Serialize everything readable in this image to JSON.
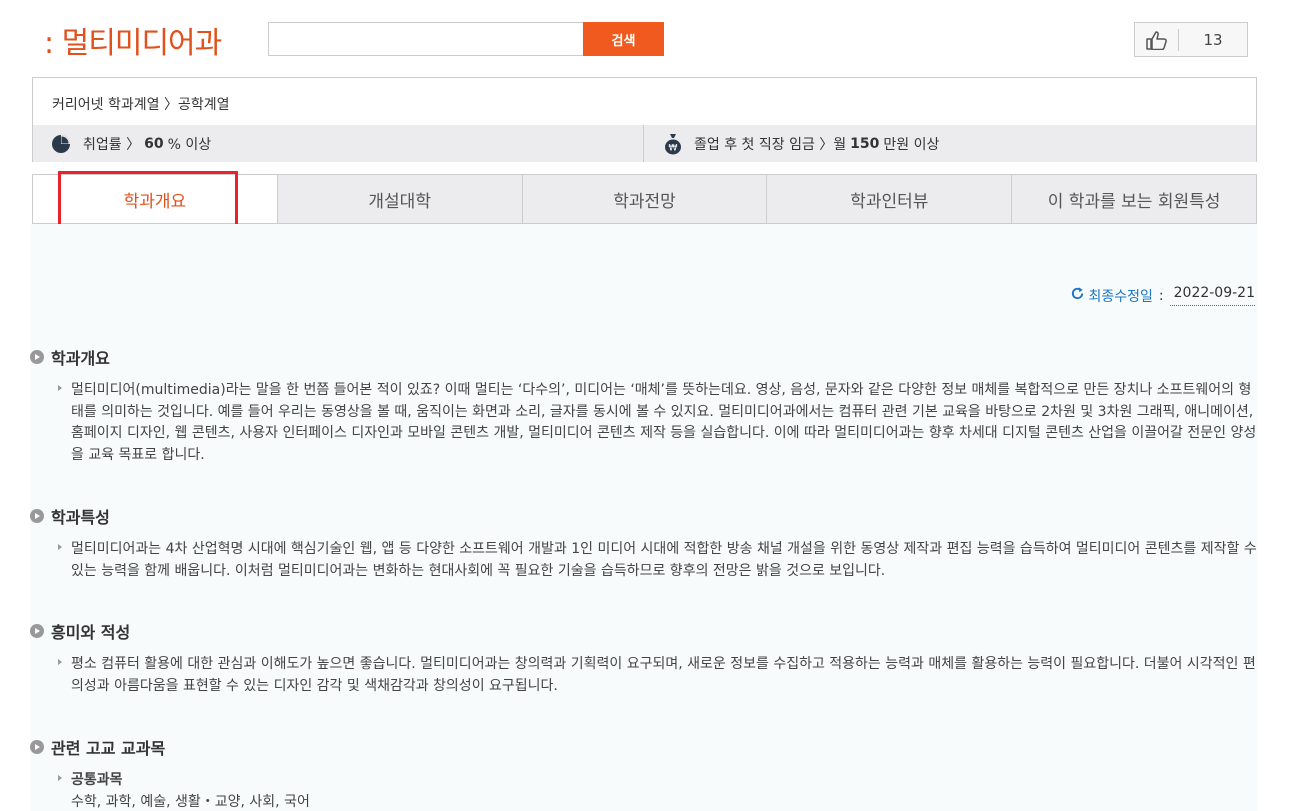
{
  "header": {
    "title": ": 멀티미디어과",
    "search_placeholder": "",
    "search_button": "검색",
    "like_count": "13"
  },
  "breadcrumb": {
    "text": "커리어넷 학과계열 〉공학계열"
  },
  "stats": {
    "employment_label": "취업률 〉",
    "employment_value": "60",
    "employment_unit": "% 이상",
    "salary_label": "졸업 후 첫 직장 임금 〉월",
    "salary_value": "150",
    "salary_unit": "만원 이상"
  },
  "tabs": [
    {
      "label": "학과개요"
    },
    {
      "label": "개설대학"
    },
    {
      "label": "학과전망"
    },
    {
      "label": "학과인터뷰"
    },
    {
      "label": "이 학과를 보는 회원특성"
    }
  ],
  "updated": {
    "label": "최종수정일",
    "separator": ":",
    "date": "2022-09-21"
  },
  "sections": [
    {
      "title": "학과개요",
      "body": "멀티미디어(multimedia)라는 말을 한 번쯤 들어본 적이 있죠? 이때 멀티는 ‘다수의’, 미디어는 ‘매체’를 뜻하는데요. 영상, 음성, 문자와 같은 다양한 정보 매체를 복합적으로 만든 장치나 소프트웨어의 형태를 의미하는 것입니다. 예를 들어 우리는 동영상을 볼 때, 움직이는 화면과 소리, 글자를 동시에 볼 수 있지요. 멀티미디어과에서는 컴퓨터 관련 기본 교육을 바탕으로 2차원 및 3차원 그래픽, 애니메이션, 홈페이지 디자인, 웹 콘텐츠, 사용자 인터페이스 디자인과 모바일 콘텐츠 개발, 멀티미디어 콘텐츠 제작 등을 실습합니다. 이에 따라 멀티미디어과는 향후 차세대 디지털 콘텐츠 산업을 이끌어갈 전문인 양성을 교육 목표로 합니다."
    },
    {
      "title": "학과특성",
      "body": "멀티미디어과는 4차 산업혁명 시대에 핵심기술인 웹, 앱 등 다양한 소프트웨어 개발과 1인 미디어 시대에 적합한 방송 채널 개설을 위한 동영상 제작과 편집 능력을 습득하여 멀티미디어 콘텐츠를 제작할 수 있는 능력을 함께 배웁니다. 이처럼 멀티미디어과는 변화하는 현대사회에 꼭 필요한 기술을 습득하므로 향후의 전망은 밝을 것으로 보입니다."
    },
    {
      "title": "흥미와 적성",
      "body": "평소 컴퓨터 활용에 대한 관심과 이해도가 높으면 좋습니다. 멀티미디어과는 창의력과 기획력이 요구되며, 새로운 정보를 수집하고 적용하는 능력과 매체를 활용하는 능력이 필요합니다. 더불어 시각적인 편의성과 아름다움을 표현할 수 있는 디자인 감각 및 색채감각과 창의성이 요구됩니다."
    },
    {
      "title": "관련 고교 교과목",
      "subtitle": "공통과목",
      "body": "수학, 과학, 예술, 생활・교양, 사회, 국어"
    }
  ]
}
